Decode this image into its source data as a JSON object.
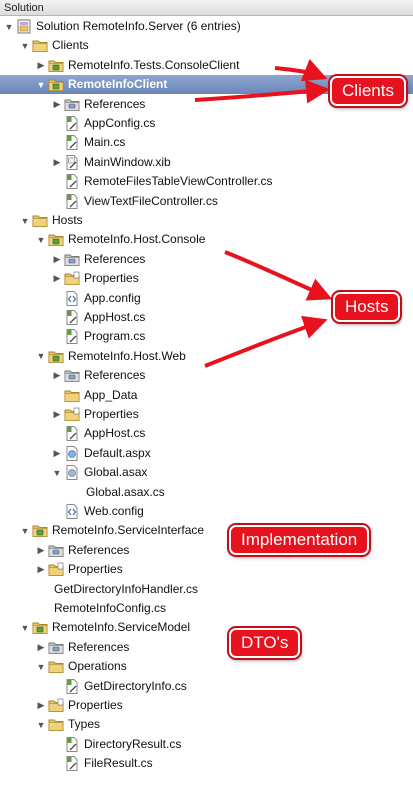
{
  "panel": {
    "title": "Solution"
  },
  "tree": [
    {
      "label": "Solution RemoteInfo.Server (6 entries)",
      "icon": "solution-icon",
      "level": 0,
      "arrow": "down"
    },
    {
      "label": "Clients",
      "icon": "folder-icon",
      "level": 1,
      "arrow": "down"
    },
    {
      "label": "RemoteInfo.Tests.ConsoleClient",
      "icon": "project-icon",
      "level": 2,
      "arrow": "right"
    },
    {
      "label": "RemoteInfoClient",
      "icon": "project-icon",
      "level": 2,
      "arrow": "down",
      "selected": true
    },
    {
      "label": "References",
      "icon": "references-icon",
      "level": 3,
      "arrow": "right"
    },
    {
      "label": "AppConfig.cs",
      "icon": "csharp-file-icon",
      "level": 3,
      "arrow": "none"
    },
    {
      "label": "Main.cs",
      "icon": "csharp-file-icon",
      "level": 3,
      "arrow": "none"
    },
    {
      "label": "MainWindow.xib",
      "icon": "xib-file-icon",
      "level": 3,
      "arrow": "right"
    },
    {
      "label": "RemoteFilesTableViewController.cs",
      "icon": "csharp-file-icon",
      "level": 3,
      "arrow": "none"
    },
    {
      "label": "ViewTextFileController.cs",
      "icon": "csharp-file-icon",
      "level": 3,
      "arrow": "none"
    },
    {
      "label": "Hosts",
      "icon": "folder-icon",
      "level": 1,
      "arrow": "down"
    },
    {
      "label": "RemoteInfo.Host.Console",
      "icon": "project-icon",
      "level": 2,
      "arrow": "down"
    },
    {
      "label": "References",
      "icon": "references-icon",
      "level": 3,
      "arrow": "right"
    },
    {
      "label": "Properties",
      "icon": "properties-folder-icon",
      "level": 3,
      "arrow": "right"
    },
    {
      "label": "App.config",
      "icon": "config-file-icon",
      "level": 3,
      "arrow": "none"
    },
    {
      "label": "AppHost.cs",
      "icon": "csharp-file-icon",
      "level": 3,
      "arrow": "none"
    },
    {
      "label": "Program.cs",
      "icon": "csharp-file-icon",
      "level": 3,
      "arrow": "none"
    },
    {
      "label": "RemoteInfo.Host.Web",
      "icon": "project-icon",
      "level": 2,
      "arrow": "down"
    },
    {
      "label": "References",
      "icon": "references-icon",
      "level": 3,
      "arrow": "right"
    },
    {
      "label": "App_Data",
      "icon": "folder-icon",
      "level": 3,
      "arrow": "none"
    },
    {
      "label": "Properties",
      "icon": "properties-folder-icon",
      "level": 3,
      "arrow": "right"
    },
    {
      "label": "AppHost.cs",
      "icon": "csharp-file-icon",
      "level": 3,
      "arrow": "none"
    },
    {
      "label": "Default.aspx",
      "icon": "aspx-file-icon",
      "level": 3,
      "arrow": "right"
    },
    {
      "label": "Global.asax",
      "icon": "asax-file-icon",
      "level": 3,
      "arrow": "down"
    },
    {
      "label": "Global.asax.cs",
      "icon": "none",
      "level": 4,
      "arrow": "none"
    },
    {
      "label": "Web.config",
      "icon": "config-file-icon",
      "level": 3,
      "arrow": "none"
    },
    {
      "label": "RemoteInfo.ServiceInterface",
      "icon": "project-icon",
      "level": 1,
      "arrow": "down"
    },
    {
      "label": "References",
      "icon": "references-icon",
      "level": 2,
      "arrow": "right"
    },
    {
      "label": "Properties",
      "icon": "properties-folder-icon",
      "level": 2,
      "arrow": "right"
    },
    {
      "label": "GetDirectoryInfoHandler.cs",
      "icon": "none",
      "level": 2,
      "arrow": "none"
    },
    {
      "label": "RemoteInfoConfig.cs",
      "icon": "none",
      "level": 2,
      "arrow": "none"
    },
    {
      "label": "RemoteInfo.ServiceModel",
      "icon": "project-icon",
      "level": 1,
      "arrow": "down"
    },
    {
      "label": "References",
      "icon": "references-icon",
      "level": 2,
      "arrow": "right"
    },
    {
      "label": "Operations",
      "icon": "folder-icon",
      "level": 2,
      "arrow": "down"
    },
    {
      "label": "GetDirectoryInfo.cs",
      "icon": "csharp-file-icon",
      "level": 3,
      "arrow": "none"
    },
    {
      "label": "Properties",
      "icon": "properties-folder-icon",
      "level": 2,
      "arrow": "right"
    },
    {
      "label": "Types",
      "icon": "folder-icon",
      "level": 2,
      "arrow": "down"
    },
    {
      "label": "DirectoryResult.cs",
      "icon": "csharp-file-icon",
      "level": 3,
      "arrow": "none"
    },
    {
      "label": "FileResult.cs",
      "icon": "csharp-file-icon",
      "level": 3,
      "arrow": "none"
    }
  ],
  "callouts": {
    "clients": "Clients",
    "hosts": "Hosts",
    "implementation": "Implementation",
    "dtos": "DTO's"
  },
  "colors": {
    "callout_red": "#e8121e",
    "selection": "#7690c1",
    "folder": "#e7c56b",
    "csharp": "#4f8a3c"
  }
}
